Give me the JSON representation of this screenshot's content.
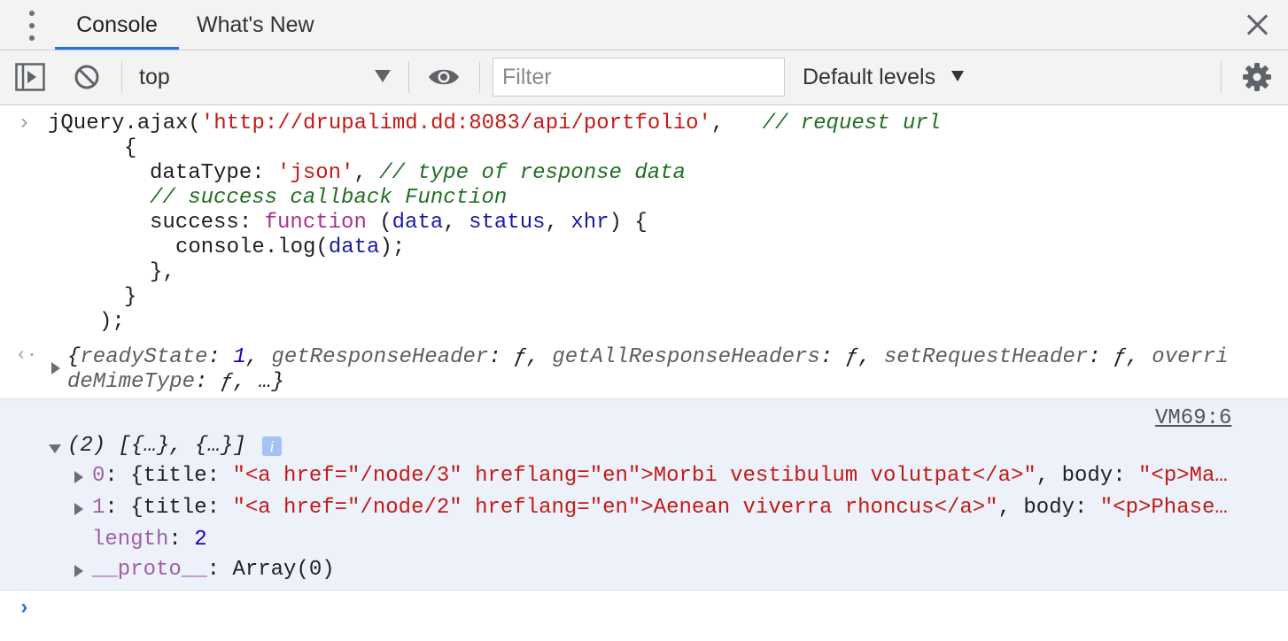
{
  "tabs": [
    {
      "label": "Console"
    },
    {
      "label": "What's New"
    }
  ],
  "toolbar": {
    "context": "top",
    "filter_placeholder": "Filter",
    "levels": "Default levels"
  },
  "input": {
    "line1_pre": "jQuery.ajax(",
    "line1_url": "'http://drupalimd.dd:8083/api/portfolio'",
    "line1_comma": ",",
    "line1_comment": "// request url",
    "line2": "{",
    "line3_key": "dataType: ",
    "line3_val": "'json'",
    "line3_comma": ", ",
    "line3_comment": "// type of response data",
    "line4_comment": "// success callback Function",
    "line5_key": "success: ",
    "line5_kw": "function",
    "line5_open": " (",
    "line5_p1": "data",
    "line5_c1": ", ",
    "line5_p2": "status",
    "line5_c2": ", ",
    "line5_p3": "xhr",
    "line5_close": ") {",
    "line6_pre": "console.log(",
    "line6_arg": "data",
    "line6_post": ");",
    "line7": "},",
    "line8": "}",
    "line9": ");"
  },
  "return_value": {
    "line1": {
      "open": "{",
      "k1": "readyState",
      "colon": ": ",
      "v1": "1",
      "sep": ", ",
      "k2": "getResponseHeader",
      "f": "ƒ",
      "k3": "getAllResponseHeaders",
      "k4": "setRequestHeader",
      "k5_part": "overri"
    },
    "line2": {
      "k5_rest": "deMimeType",
      "colon": ": ",
      "f": "ƒ",
      "tail": ", …}"
    }
  },
  "log": {
    "source": "VM69:6",
    "summary": "(2) [{…}, {…}]",
    "info_icon": "i",
    "items": [
      {
        "index": "0",
        "pre": ": {title: ",
        "title": "\"<a href=\"/node/3\" hreflang=\"en\">Morbi vestibulum volutpat</a>\"",
        "mid": ", body: ",
        "body": "\"<p>Ma…"
      },
      {
        "index": "1",
        "pre": ": {title: ",
        "title": "\"<a href=\"/node/2\" hreflang=\"en\">Aenean viverra rhoncus</a>\"",
        "mid": ", body: ",
        "body": "\"<p>Phase…"
      }
    ],
    "length_key": "length",
    "length_colon": ": ",
    "length_val": "2",
    "proto_key": "__proto__",
    "proto_colon": ": ",
    "proto_val": "Array(0)"
  },
  "icons": {
    "prompt_in": "›",
    "prompt_out": "‹·",
    "prompt_new": "›"
  }
}
